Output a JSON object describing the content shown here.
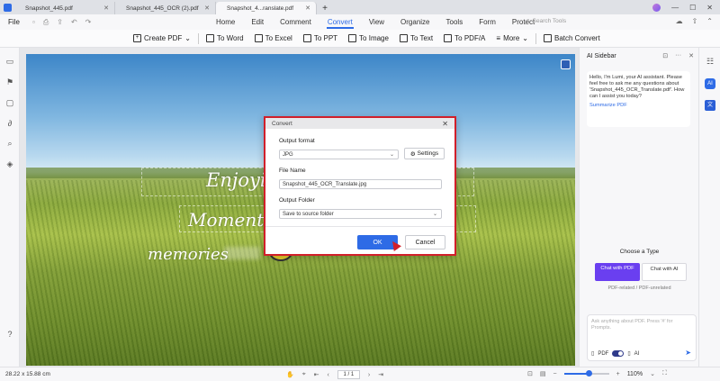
{
  "tabs": [
    {
      "label": "Snapshot_445.pdf"
    },
    {
      "label": "Snapshot_445_OCR (2).pdf"
    },
    {
      "label": "Snapshot_4...ranslate.pdf"
    }
  ],
  "menubar": {
    "file": "File",
    "items": [
      "Home",
      "Edit",
      "Comment",
      "Convert",
      "View",
      "Organize",
      "Tools",
      "Form",
      "Protect"
    ],
    "active": "Convert",
    "search_placeholder": "Search Tools"
  },
  "toolbar": {
    "create_pdf": "Create PDF",
    "to_word": "To Word",
    "to_excel": "To Excel",
    "to_ppt": "To PPT",
    "to_image": "To Image",
    "to_text": "To Text",
    "to_pdfa": "To PDF/A",
    "more": "More",
    "batch_convert": "Batch Convert"
  },
  "page": {
    "line1": "Enjoyin",
    "line2": "Moments",
    "line3": "memories"
  },
  "dialog": {
    "title": "Convert",
    "output_format_label": "Output format",
    "output_format_value": "JPG",
    "settings_label": "Settings",
    "file_name_label": "File Name",
    "file_name_value": "Snapshot_445_OCR_Translate.jpg",
    "output_folder_label": "Output Folder",
    "output_folder_value": "Save to source folder",
    "ok_label": "OK",
    "cancel_label": "Cancel"
  },
  "ai_sidebar": {
    "title": "AI Sidebar",
    "greeting": "Hello, I'm Lumi, your AI assistant. Please feel free to ask me any questions about 'Snapshot_445_OCR_Translate.pdf'. How can I assist you today?",
    "summarize": "Summarize PDF",
    "choose_type": "Choose a Type",
    "chat_pdf": "Chat with PDF",
    "chat_ai": "Chat with AI",
    "pdf_related": "PDF-related / PDF-unrelated",
    "ask_placeholder": "Ask anything about PDF. Press '#' for Prompts.",
    "pdf_toggle_label": "PDF",
    "ai_toggle_label": "AI"
  },
  "statusbar": {
    "dimensions": "28.22 x 15.88 cm",
    "page_current": "1 / 1",
    "zoom": "110%",
    "zoom_fraction": 0.55
  },
  "colors": {
    "accent": "#2e6be6",
    "highlight_border": "#d11f2a",
    "chat_pdf": "#6a3ff0"
  }
}
